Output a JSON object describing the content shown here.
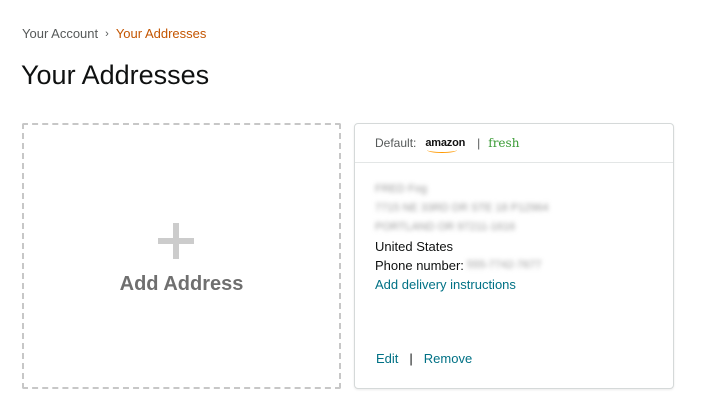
{
  "breadcrumb": {
    "parent": "Your Account",
    "separator": "›",
    "current": "Your Addresses"
  },
  "page": {
    "title": "Your Addresses"
  },
  "add_card": {
    "icon": "plus-icon",
    "label": "Add Address"
  },
  "address_card": {
    "default_label": "Default:",
    "brand_amazon": "amazon",
    "brand_separator": "|",
    "brand_fresh": "fresh",
    "name_redacted": "FRED Fog",
    "street_redacted": "7715 NE 33RD DR STE 18 P12964",
    "city_redacted": "PORTLAND OR 97211-1616",
    "country": "United States",
    "phone_label": "Phone number:",
    "phone_redacted": "555-7742-7677",
    "delivery_link": "Add delivery instructions",
    "edit": "Edit",
    "action_separator": "|",
    "remove": "Remove"
  },
  "colors": {
    "accent_link": "#007185",
    "breadcrumb_current": "#c45500",
    "fresh_green": "#3a9b35",
    "amazon_orange": "#ff9900"
  }
}
